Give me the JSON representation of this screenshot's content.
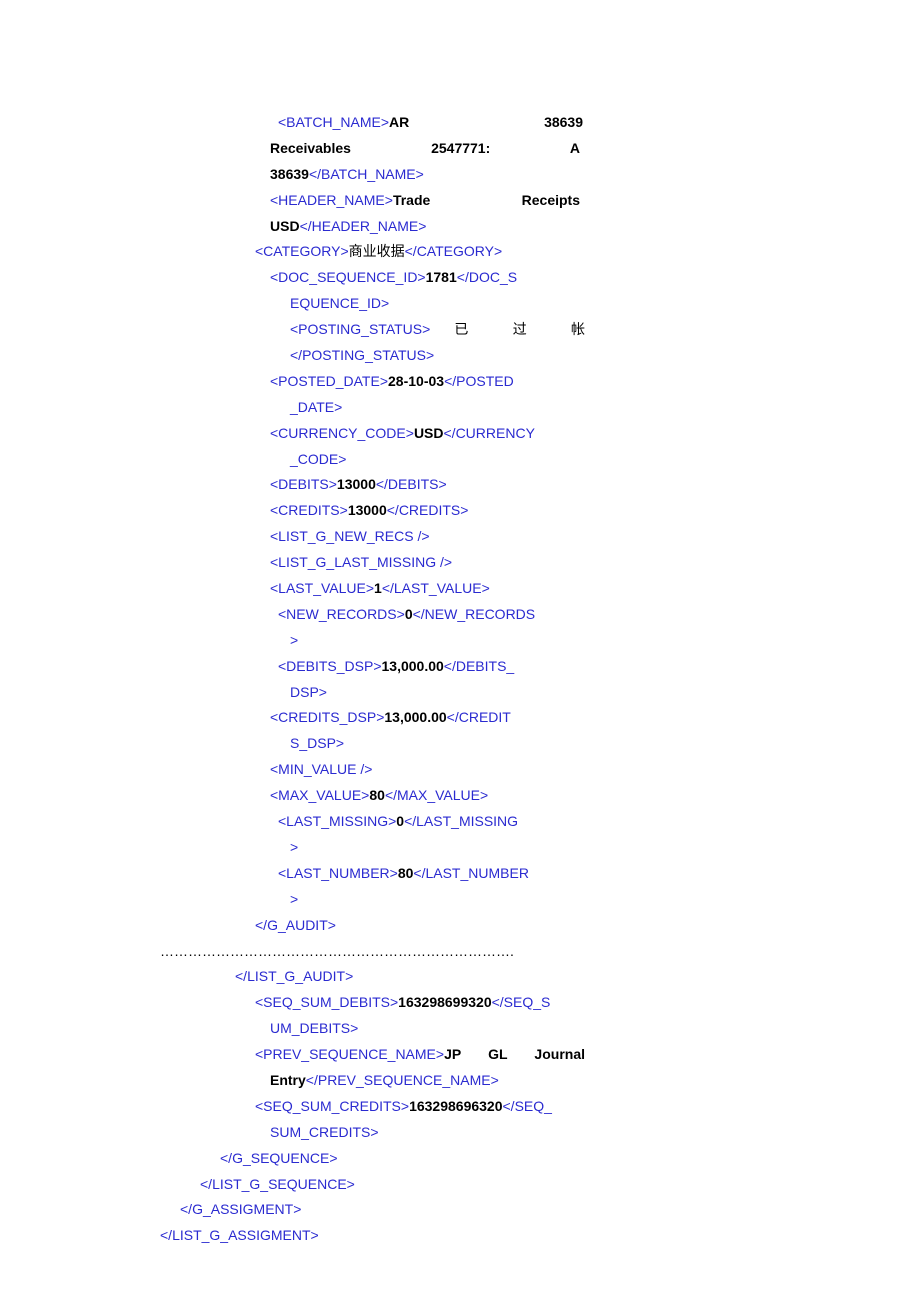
{
  "batch_name": "AR 38639 Receivables 2547771: A 38639",
  "header_name": "Trade Receipts USD",
  "category": "商业收据",
  "doc_sequence_id": "1781",
  "posting_status": " 已 过 帐 ",
  "posted_date": "28-10-03",
  "currency_code": "USD",
  "debits": "13000",
  "credits": "13000",
  "last_value": "1",
  "new_records": "0",
  "debits_dsp": "13,000.00",
  "credits_dsp": "13,000.00",
  "max_value": "80",
  "last_missing": "0",
  "last_number": "80",
  "seq_sum_debits": "163298699320",
  "prev_sequence_name": "JP GL Journal Entry",
  "seq_sum_credits": "163298696320",
  "dots": "………………………………………………………………….",
  "tags": {
    "batch_name_o": "<BATCH_NAME>",
    "batch_name_c": "</BATCH_NAME>",
    "header_name_o": "<HEADER_NAME>",
    "header_name_c": "</HEADER_NAME>",
    "category_o": "<CATEGORY>",
    "category_c": "</CATEGORY>",
    "doc_seq_o": "<DOC_SEQUENCE_ID>",
    "doc_seq_c1": "</DOC_S",
    "doc_seq_c2": "EQUENCE_ID>",
    "posting_o": "<POSTING_STATUS>",
    "posting_c": "</POSTING_STATUS>",
    "posted_o": "<POSTED_DATE>",
    "posted_c1": "</POSTED",
    "posted_c2": "_DATE>",
    "curr_o": "<CURRENCY_CODE>",
    "curr_c1": "</CURRENCY",
    "curr_c2": "_CODE>",
    "debits_o": "<DEBITS>",
    "debits_c": "</DEBITS>",
    "credits_o": "<CREDITS>",
    "credits_c": "</CREDITS>",
    "list_new_recs": "<LIST_G_NEW_RECS />",
    "list_last_missing": "<LIST_G_LAST_MISSING />",
    "last_value_o": "<LAST_VALUE>",
    "last_value_c": "</LAST_VALUE>",
    "new_records_o": "<NEW_RECORDS>",
    "new_records_c1": "</NEW_RECORDS",
    "gt": ">",
    "debits_dsp_o": "<DEBITS_DSP>",
    "debits_dsp_c1": "</DEBITS_",
    "debits_dsp_c2": "DSP>",
    "credits_dsp_o": "<CREDITS_DSP>",
    "credits_dsp_c1": "</CREDIT",
    "credits_dsp_c2": "S_DSP>",
    "min_value": "<MIN_VALUE />",
    "max_value_o": "<MAX_VALUE>",
    "max_value_c": "</MAX_VALUE>",
    "last_missing_o": "<LAST_MISSING>",
    "last_missing_c1": "</LAST_MISSING",
    "last_number_o": "<LAST_NUMBER>",
    "last_number_c1": "</LAST_NUMBER",
    "g_audit_c": "</G_AUDIT>",
    "list_g_audit_c": "</LIST_G_AUDIT>",
    "seq_sum_d_o": "<SEQ_SUM_DEBITS>",
    "seq_sum_d_c1": "</SEQ_S",
    "seq_sum_d_c2": "UM_DEBITS>",
    "prev_seq_o": "<PREV_SEQUENCE_NAME>",
    "prev_seq_c": "</PREV_SEQUENCE_NAME>",
    "seq_sum_c_o": "<SEQ_SUM_CREDITS>",
    "seq_sum_c_c1": "</SEQ_",
    "seq_sum_c_c2": "SUM_CREDITS>",
    "g_sequence_c": "</G_SEQUENCE>",
    "list_g_sequence_c": "</LIST_G_SEQUENCE>",
    "g_assigment_c": "</G_ASSIGMENT>",
    "list_g_assigment_c": "</LIST_G_ASSIGMENT>"
  }
}
